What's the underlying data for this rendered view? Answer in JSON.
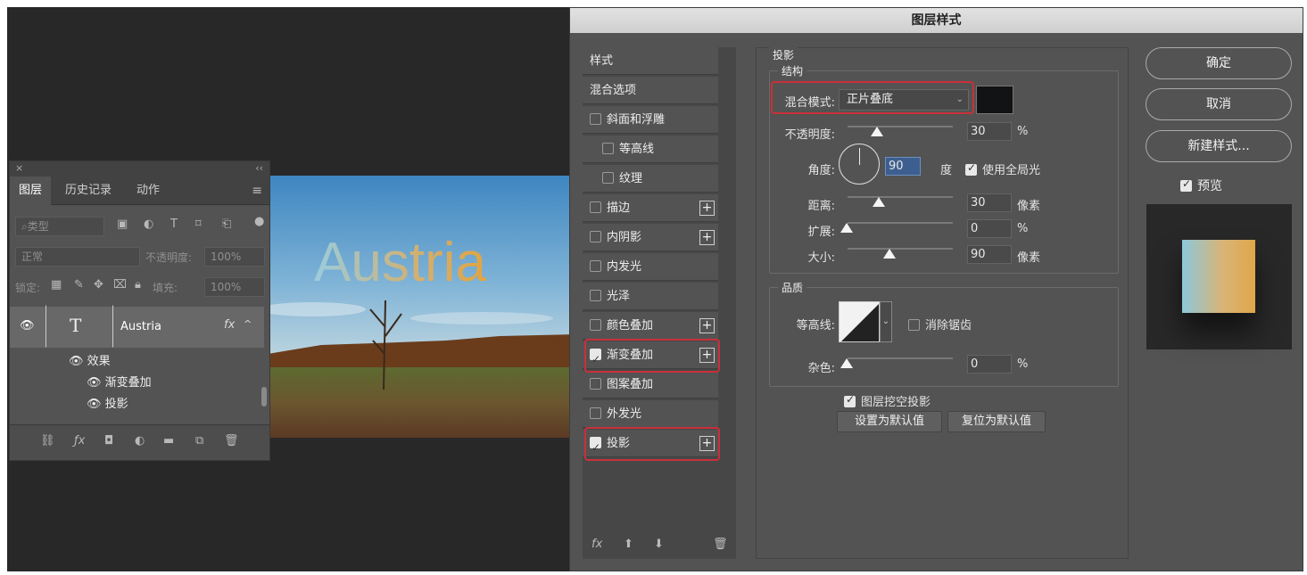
{
  "layers_panel": {
    "close": "×",
    "collapse": "‹‹",
    "tabs": [
      "图层",
      "历史记录",
      "动作"
    ],
    "filter_label": "类型",
    "blend_mode": "正常",
    "opacity_label": "不透明度:",
    "opacity_value": "100%",
    "lock_label": "锁定:",
    "fill_label": "填充:",
    "fill_value": "100%",
    "layer_name": "Austria",
    "layer_thumb": "T",
    "fx_badge": "fx",
    "effects_label": "效果",
    "effect_items": [
      "渐变叠加",
      "投影"
    ]
  },
  "canvas": {
    "text": "Austria"
  },
  "dialog": {
    "title": "图层样式",
    "style_list": {
      "header": "样式",
      "blend_options": "混合选项",
      "items": [
        {
          "label": "斜面和浮雕",
          "checked": false,
          "plus": false,
          "indent": false
        },
        {
          "label": "等高线",
          "checked": false,
          "plus": false,
          "indent": true
        },
        {
          "label": "纹理",
          "checked": false,
          "plus": false,
          "indent": true
        },
        {
          "label": "描边",
          "checked": false,
          "plus": true,
          "indent": false
        },
        {
          "label": "内阴影",
          "checked": false,
          "plus": true,
          "indent": false
        },
        {
          "label": "内发光",
          "checked": false,
          "plus": false,
          "indent": false
        },
        {
          "label": "光泽",
          "checked": false,
          "plus": false,
          "indent": false
        },
        {
          "label": "颜色叠加",
          "checked": false,
          "plus": true,
          "indent": false
        },
        {
          "label": "渐变叠加",
          "checked": true,
          "plus": true,
          "indent": false
        },
        {
          "label": "图案叠加",
          "checked": false,
          "plus": false,
          "indent": false
        },
        {
          "label": "外发光",
          "checked": false,
          "plus": false,
          "indent": false
        },
        {
          "label": "投影",
          "checked": true,
          "plus": true,
          "indent": false
        }
      ],
      "footer_fx": "fx"
    },
    "drop_shadow": {
      "section_title": "投影",
      "structure_title": "结构",
      "blend_mode_label": "混合模式:",
      "blend_mode_value": "正片叠底",
      "shadow_color": "#111315",
      "opacity_label": "不透明度:",
      "opacity_value": "30",
      "opacity_unit": "%",
      "angle_label": "角度:",
      "angle_value": "90",
      "angle_unit": "度",
      "global_light_label": "使用全局光",
      "global_light_checked": true,
      "distance_label": "距离:",
      "distance_value": "30",
      "distance_unit": "像素",
      "spread_label": "扩展:",
      "spread_value": "0",
      "spread_unit": "%",
      "size_label": "大小:",
      "size_value": "90",
      "size_unit": "像素",
      "quality_title": "品质",
      "contour_label": "等高线:",
      "antialias_label": "消除锯齿",
      "antialias_checked": false,
      "noise_label": "杂色:",
      "noise_value": "0",
      "noise_unit": "%",
      "knockout_label": "图层挖空投影",
      "knockout_checked": true,
      "set_default": "设置为默认值",
      "reset_default": "复位为默认值"
    },
    "buttons": {
      "ok": "确定",
      "cancel": "取消",
      "new_style": "新建样式...",
      "preview_label": "预览",
      "preview_checked": true
    }
  }
}
